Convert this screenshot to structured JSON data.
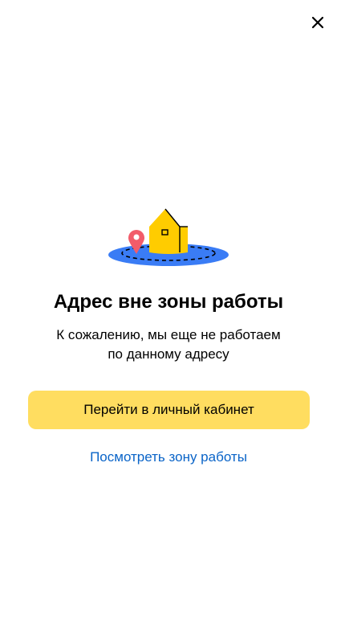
{
  "dialog": {
    "close_icon": "close-icon",
    "illustration_icon": "house-outside-zone-illustration",
    "title": "Адрес вне зоны работы",
    "subtitle_line1": "К сожалению, мы еще не работаем",
    "subtitle_line2": "по данному адресу",
    "primary_button_label": "Перейти в личный кабинет",
    "link_label": "Посмотреть зону работы"
  },
  "colors": {
    "primary_button_bg": "#ffdd60",
    "link": "#0a64c8",
    "zone_blue": "#3a7cf5",
    "house_yellow": "#ffcc00",
    "pin_red": "#f25c6a"
  }
}
